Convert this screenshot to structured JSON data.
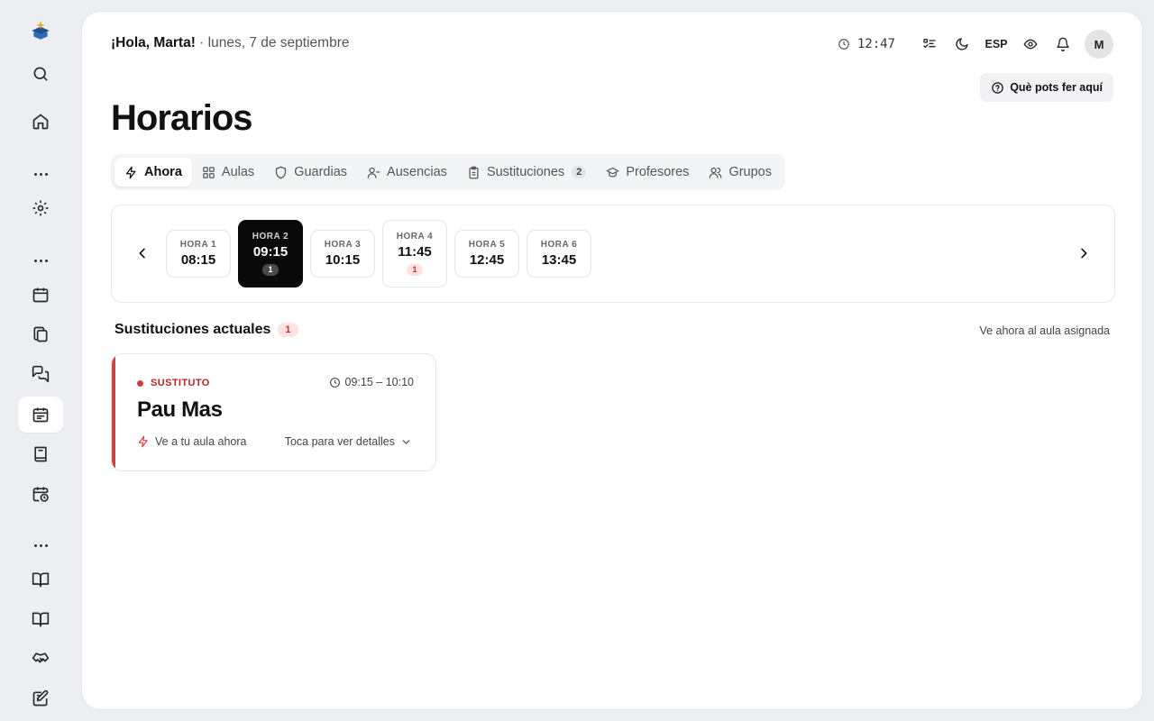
{
  "header": {
    "greeting": "¡Hola, Marta!",
    "separator": " · ",
    "date": "lunes, 7 de septiembre",
    "clock": "12:47",
    "language": "ESP",
    "avatar_initial": "M",
    "help_label": "Què pots fer aquí"
  },
  "page_title": "Horarios",
  "tabs": [
    {
      "label": "Ahora",
      "icon": "bolt-icon",
      "active": true
    },
    {
      "label": "Aulas",
      "icon": "grid-icon"
    },
    {
      "label": "Guardias",
      "icon": "shield-icon"
    },
    {
      "label": "Ausencias",
      "icon": "user-minus-icon"
    },
    {
      "label": "Sustituciones",
      "icon": "clipboard-icon",
      "count": "2"
    },
    {
      "label": "Profesores",
      "icon": "graduation-cap-icon"
    },
    {
      "label": "Grupos",
      "icon": "users-icon"
    }
  ],
  "hours": [
    {
      "label": "HORA 1",
      "time": "08:15"
    },
    {
      "label": "HORA 2",
      "time": "09:15",
      "badge": "1",
      "active": true
    },
    {
      "label": "HORA 3",
      "time": "10:15"
    },
    {
      "label": "HORA 4",
      "time": "11:45",
      "badge": "1"
    },
    {
      "label": "HORA 5",
      "time": "12:45"
    },
    {
      "label": "HORA 6",
      "time": "13:45"
    }
  ],
  "substitutions": {
    "title": "Sustituciones actuales",
    "count": "1",
    "hint": "Ve ahora al aula asignada",
    "items": [
      {
        "role": "SUSTITUTO",
        "time_range": "09:15 – 10:10",
        "teacher": "Pau Mas",
        "action": "Ve a tu aula ahora",
        "details": "Toca para ver detalles"
      }
    ]
  },
  "colors": {
    "accent_red": "#c94545",
    "badge_red_bg": "#fde2e2",
    "active_hour_bg": "#0a0a0a",
    "background": "#eceef2"
  },
  "sidebar": {
    "icons": [
      "logo-icon",
      "search-icon",
      "home-icon",
      "more-icon",
      "settings-icon",
      "more-icon",
      "calendar-icon",
      "documents-icon",
      "messages-icon",
      "schedule-icon",
      "book-icon",
      "calendar-clock-icon",
      "more-icon",
      "open-book-icon",
      "open-book-icon",
      "handshake-icon",
      "edit-icon"
    ]
  }
}
